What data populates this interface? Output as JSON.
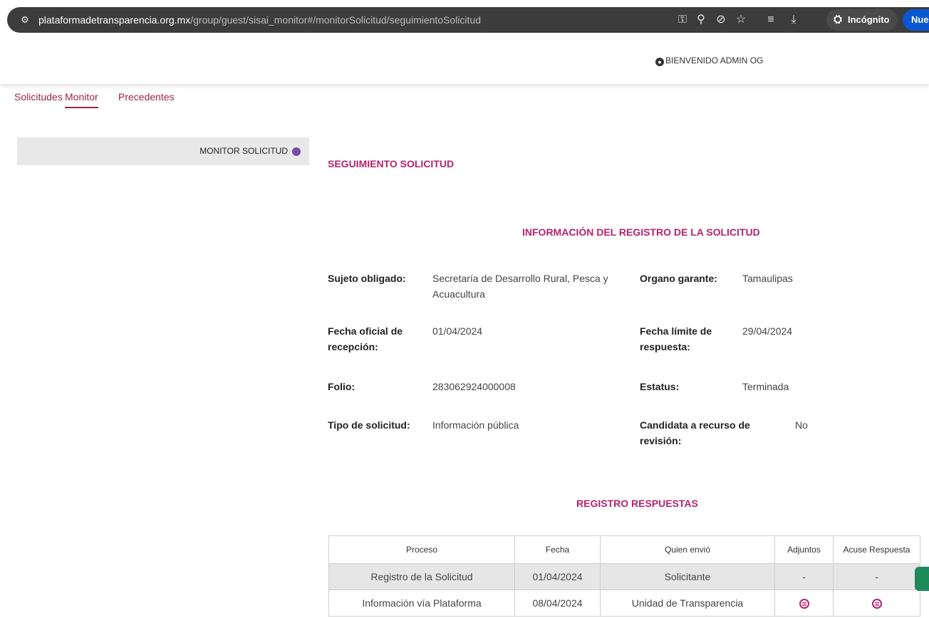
{
  "browser": {
    "url_host": "plataformadetransparencia.org.mx",
    "url_path": "/group/guest/sisai_monitor#/monitorSolicitud/seguimientoSolicitud",
    "incognito_label": "Incógnito",
    "new_label": "Nue"
  },
  "header": {
    "welcome": "BIENVENIDO ADMIN OG"
  },
  "nav": {
    "tabs": [
      {
        "label": "Solicitudes"
      },
      {
        "label": "Monitor"
      },
      {
        "label": "Precedentes"
      }
    ]
  },
  "sidebar": {
    "item_label": "MONITOR SOLICITUD"
  },
  "main": {
    "section_title": "SEGUIMIENTO SOLICITUD",
    "info_title": "INFORMACIÓN DEL REGISTRO DE LA SOLICITUD",
    "fields": {
      "sujeto_label": "Sujeto obligado:",
      "sujeto_value": "Secretaría de Desarrollo Rural, Pesca y Acuacultura",
      "organo_label": "Organo garante:",
      "organo_value": "Tamaulipas",
      "fecha_oficial_label": "Fecha oficial de recepción:",
      "fecha_oficial_value": "01/04/2024",
      "fecha_limite_label": "Fecha límite de respuesta:",
      "fecha_limite_value": "29/04/2024",
      "folio_label": "Folio:",
      "folio_value": "283062924000008",
      "estatus_label": "Estatus:",
      "estatus_value": "Terminada",
      "tipo_label": "Tipo de solicitud:",
      "tipo_value": "Información pública",
      "candidata_label": "Candidata a recurso de revisión:",
      "candidata_value": "No"
    },
    "responses_title": "REGISTRO RESPUESTAS",
    "table": {
      "headers": [
        "Proceso",
        "Fecha",
        "Quien envió",
        "Adjuntos",
        "Acuse Respuesta"
      ],
      "rows": [
        {
          "proceso": "Registro de la Solicitud",
          "fecha": "01/04/2024",
          "quien": "Solicitante",
          "adjuntos": "-",
          "acuse": "-"
        },
        {
          "proceso": "Información vía Plataforma",
          "fecha": "08/04/2024",
          "quien": "Unidad de Transparencia",
          "adjuntos": "",
          "acuse": ""
        }
      ]
    }
  },
  "colors": {
    "accent": "#b5236e",
    "nav": "#9d2449",
    "row_alt": "#e6e6e6"
  }
}
